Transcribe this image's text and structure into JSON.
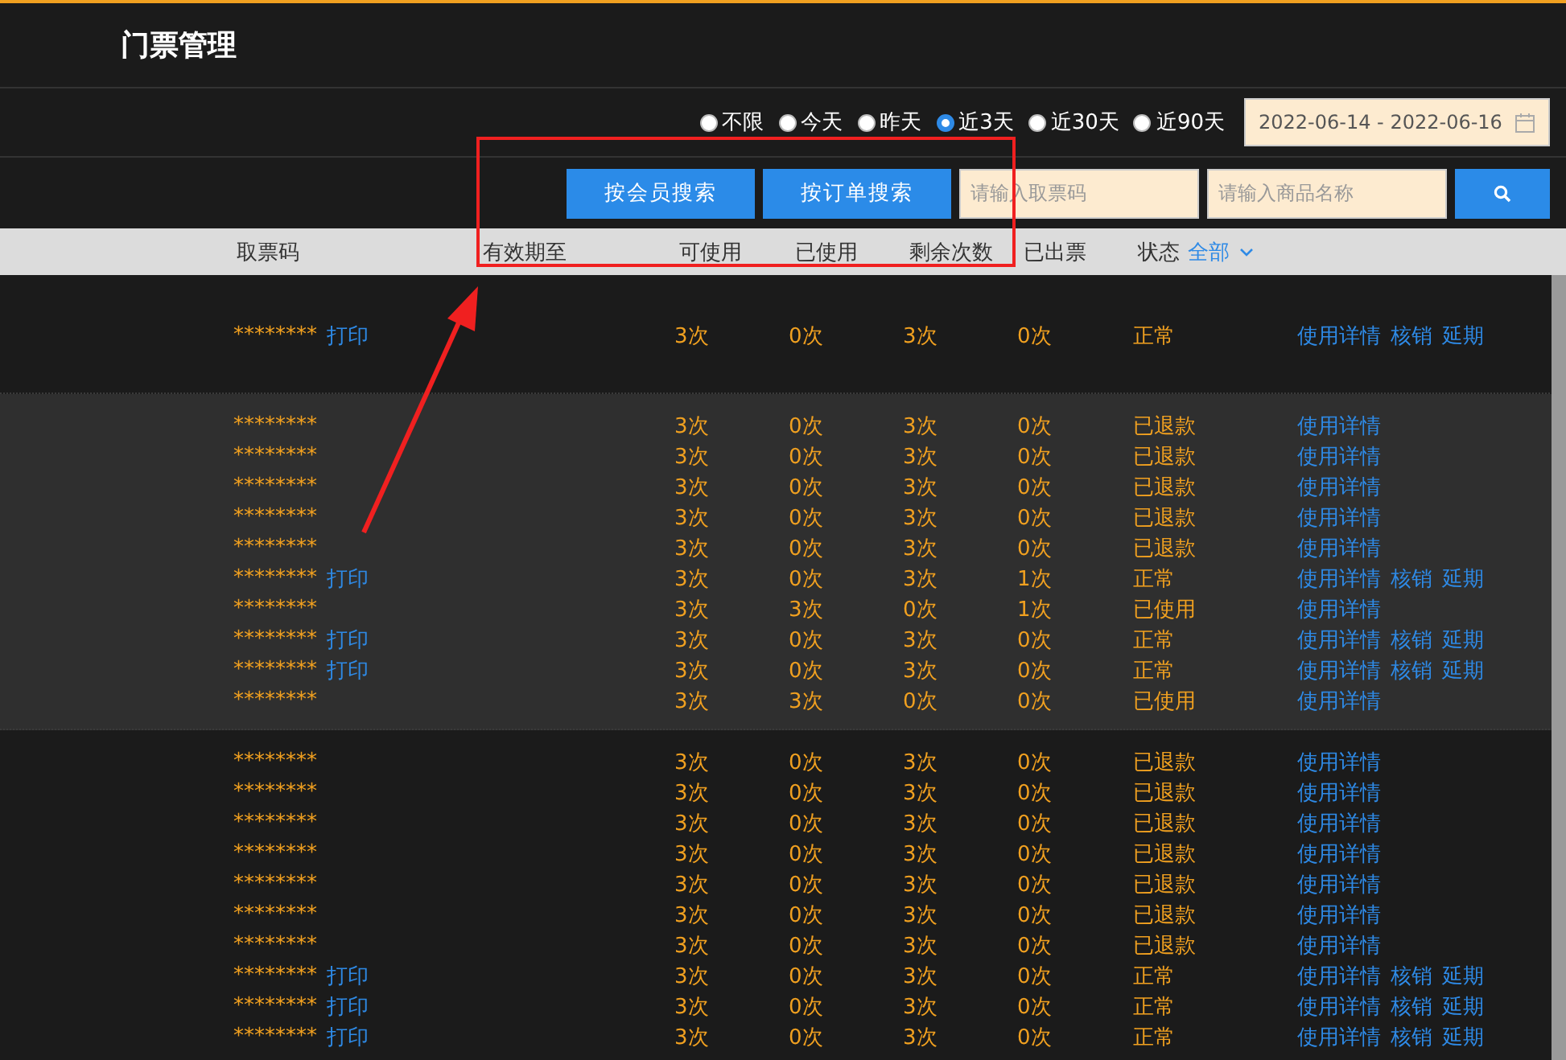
{
  "page_title": "门票管理",
  "date_filter": {
    "options": [
      {
        "label": "不限",
        "selected": false
      },
      {
        "label": "今天",
        "selected": false
      },
      {
        "label": "昨天",
        "selected": false
      },
      {
        "label": "近3天",
        "selected": true
      },
      {
        "label": "近30天",
        "selected": false
      },
      {
        "label": "近90天",
        "selected": false
      }
    ],
    "range": "2022-06-14 - 2022-06-16"
  },
  "search": {
    "buttons": [
      "按会员搜索",
      "按订单搜索"
    ],
    "fields": [
      {
        "placeholder": "请输入取票码"
      },
      {
        "placeholder": "请输入商品名称"
      }
    ]
  },
  "table": {
    "columns": [
      "取票码",
      "有效期至",
      "可使用",
      "已使用",
      "剩余次数",
      "已出票",
      "状态"
    ],
    "status_filter": "全部",
    "groups": [
      {
        "rows": [
          {
            "code": "********",
            "print": "打印",
            "available": "3次",
            "used": "0次",
            "remaining": "3次",
            "issued": "0次",
            "status": "正常",
            "actions": [
              "使用详情",
              "核销",
              "延期"
            ]
          }
        ]
      },
      {
        "rows": [
          {
            "code": "********",
            "available": "3次",
            "used": "0次",
            "remaining": "3次",
            "issued": "0次",
            "status": "已退款",
            "actions": [
              "使用详情"
            ]
          },
          {
            "code": "********",
            "available": "3次",
            "used": "0次",
            "remaining": "3次",
            "issued": "0次",
            "status": "已退款",
            "actions": [
              "使用详情"
            ]
          },
          {
            "code": "********",
            "available": "3次",
            "used": "0次",
            "remaining": "3次",
            "issued": "0次",
            "status": "已退款",
            "actions": [
              "使用详情"
            ]
          },
          {
            "code": "********",
            "available": "3次",
            "used": "0次",
            "remaining": "3次",
            "issued": "0次",
            "status": "已退款",
            "actions": [
              "使用详情"
            ]
          },
          {
            "code": "********",
            "available": "3次",
            "used": "0次",
            "remaining": "3次",
            "issued": "0次",
            "status": "已退款",
            "actions": [
              "使用详情"
            ]
          },
          {
            "code": "********",
            "print": "打印",
            "available": "3次",
            "used": "0次",
            "remaining": "3次",
            "issued": "1次",
            "status": "正常",
            "actions": [
              "使用详情",
              "核销",
              "延期"
            ]
          },
          {
            "code": "********",
            "available": "3次",
            "used": "3次",
            "remaining": "0次",
            "issued": "1次",
            "status": "已使用",
            "actions": [
              "使用详情"
            ]
          },
          {
            "code": "********",
            "print": "打印",
            "available": "3次",
            "used": "0次",
            "remaining": "3次",
            "issued": "0次",
            "status": "正常",
            "actions": [
              "使用详情",
              "核销",
              "延期"
            ]
          },
          {
            "code": "********",
            "print": "打印",
            "available": "3次",
            "used": "0次",
            "remaining": "3次",
            "issued": "0次",
            "status": "正常",
            "actions": [
              "使用详情",
              "核销",
              "延期"
            ]
          },
          {
            "code": "********",
            "available": "3次",
            "used": "3次",
            "remaining": "0次",
            "issued": "0次",
            "status": "已使用",
            "actions": [
              "使用详情"
            ]
          }
        ]
      },
      {
        "rows": [
          {
            "code": "********",
            "available": "3次",
            "used": "0次",
            "remaining": "3次",
            "issued": "0次",
            "status": "已退款",
            "actions": [
              "使用详情"
            ]
          },
          {
            "code": "********",
            "available": "3次",
            "used": "0次",
            "remaining": "3次",
            "issued": "0次",
            "status": "已退款",
            "actions": [
              "使用详情"
            ]
          },
          {
            "code": "********",
            "available": "3次",
            "used": "0次",
            "remaining": "3次",
            "issued": "0次",
            "status": "已退款",
            "actions": [
              "使用详情"
            ]
          },
          {
            "code": "********",
            "available": "3次",
            "used": "0次",
            "remaining": "3次",
            "issued": "0次",
            "status": "已退款",
            "actions": [
              "使用详情"
            ]
          },
          {
            "code": "********",
            "available": "3次",
            "used": "0次",
            "remaining": "3次",
            "issued": "0次",
            "status": "已退款",
            "actions": [
              "使用详情"
            ]
          },
          {
            "code": "********",
            "available": "3次",
            "used": "0次",
            "remaining": "3次",
            "issued": "0次",
            "status": "已退款",
            "actions": [
              "使用详情"
            ]
          },
          {
            "code": "********",
            "available": "3次",
            "used": "0次",
            "remaining": "3次",
            "issued": "0次",
            "status": "已退款",
            "actions": [
              "使用详情"
            ]
          },
          {
            "code": "********",
            "print": "打印",
            "available": "3次",
            "used": "0次",
            "remaining": "3次",
            "issued": "0次",
            "status": "正常",
            "actions": [
              "使用详情",
              "核销",
              "延期"
            ]
          },
          {
            "code": "********",
            "print": "打印",
            "available": "3次",
            "used": "0次",
            "remaining": "3次",
            "issued": "0次",
            "status": "正常",
            "actions": [
              "使用详情",
              "核销",
              "延期"
            ]
          },
          {
            "code": "********",
            "print": "打印",
            "available": "3次",
            "used": "0次",
            "remaining": "3次",
            "issued": "0次",
            "status": "正常",
            "actions": [
              "使用详情",
              "核销",
              "延期"
            ]
          }
        ]
      }
    ]
  }
}
